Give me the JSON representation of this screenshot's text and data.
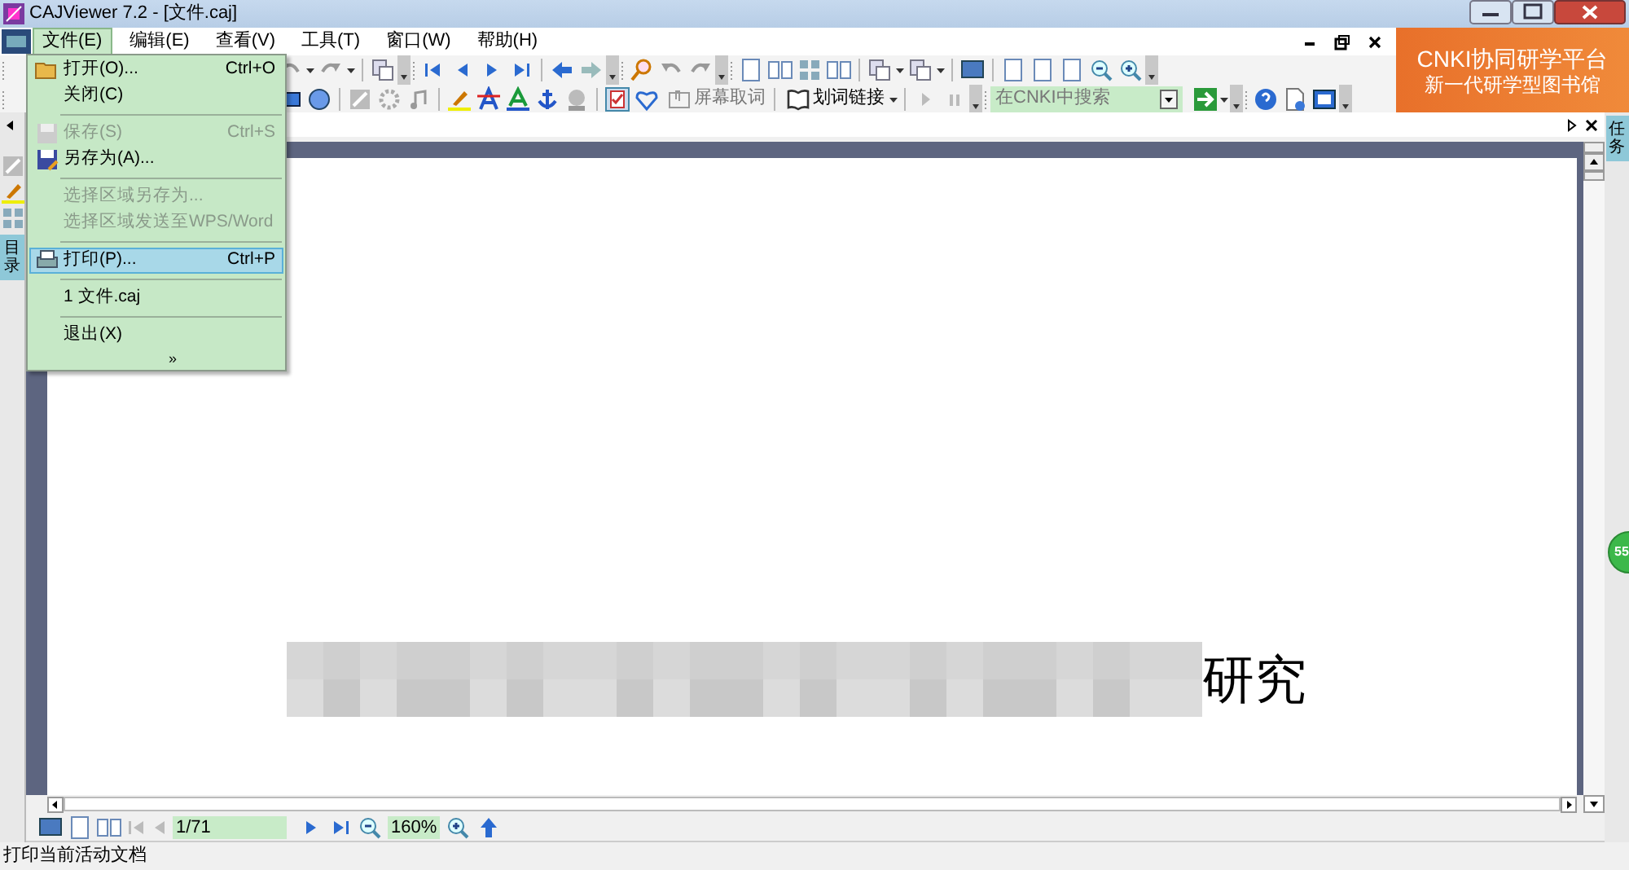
{
  "window": {
    "title": "CAJViewer 7.2 - [文件.caj]"
  },
  "menu_bar": [
    {
      "label": "文件(E)",
      "selected": true
    },
    {
      "label": "编辑(E)",
      "selected": false
    },
    {
      "label": "查看(V)",
      "selected": false
    },
    {
      "label": "工具(T)",
      "selected": false
    },
    {
      "label": "窗口(W)",
      "selected": false
    },
    {
      "label": "帮助(H)",
      "selected": false
    }
  ],
  "file_menu": [
    {
      "kind": "item",
      "label": "打开(O)...",
      "shortcut": "Ctrl+O",
      "disabled": false,
      "selected": false
    },
    {
      "kind": "item",
      "label": "关闭(C)",
      "disabled": false,
      "selected": false
    },
    {
      "kind": "separator"
    },
    {
      "kind": "item",
      "label": "保存(S)",
      "shortcut": "Ctrl+S",
      "disabled": true,
      "selected": false
    },
    {
      "kind": "item",
      "label": "另存为(A)...",
      "disabled": false,
      "selected": false
    },
    {
      "kind": "separator"
    },
    {
      "kind": "item",
      "label": "选择区域另存为...",
      "disabled": true,
      "selected": false
    },
    {
      "kind": "item",
      "label": "选择区域发送至WPS/Word",
      "disabled": true,
      "selected": false
    },
    {
      "kind": "separator"
    },
    {
      "kind": "item",
      "label": "打印(P)...",
      "shortcut": "Ctrl+P",
      "disabled": false,
      "selected": true
    },
    {
      "kind": "separator"
    },
    {
      "kind": "item",
      "label": "1 文件.caj",
      "disabled": false,
      "selected": false
    },
    {
      "kind": "separator"
    },
    {
      "kind": "item",
      "label": "退出(X)",
      "disabled": false,
      "selected": false
    },
    {
      "kind": "more",
      "label": "»"
    }
  ],
  "toolbar": {
    "screen_word_button": "屏幕取词",
    "link_button": "划词链接",
    "search": {
      "placeholder": "在CNKI中搜索"
    }
  },
  "banner": {
    "line_1": "CNKI协同研学平台",
    "line_2": "新一代研学型图书馆"
  },
  "left_panel": {
    "tab": "目录"
  },
  "right_panel": {
    "tab": "任务",
    "badge": "55"
  },
  "document": {
    "visible_text": "研究"
  },
  "page_nav": {
    "page": "1/71",
    "zoom": "160%"
  },
  "status_bar": "打印当前活动文档"
}
